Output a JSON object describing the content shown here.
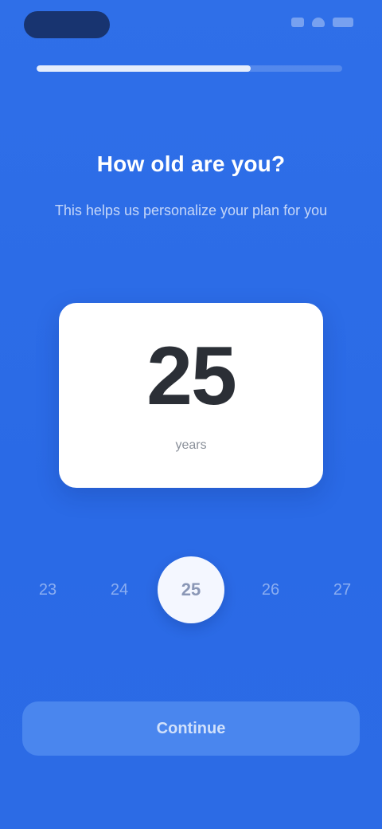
{
  "status_bar": {
    "icons": [
      "signal-icon",
      "wifi-icon",
      "battery-icon"
    ]
  },
  "progress": {
    "value": 0.7
  },
  "header": {
    "title": "How old are you?",
    "subtitle": "This helps us personalize your plan for you"
  },
  "value_card": {
    "value": "25",
    "unit": "years"
  },
  "selector": {
    "items": [
      "23",
      "24",
      "25",
      "26",
      "27"
    ],
    "selected": "25"
  },
  "actions": {
    "continue_label": "Continue"
  },
  "colors": {
    "background": "#2f70e8",
    "card": "#ffffff",
    "button": "#4a86ee"
  }
}
